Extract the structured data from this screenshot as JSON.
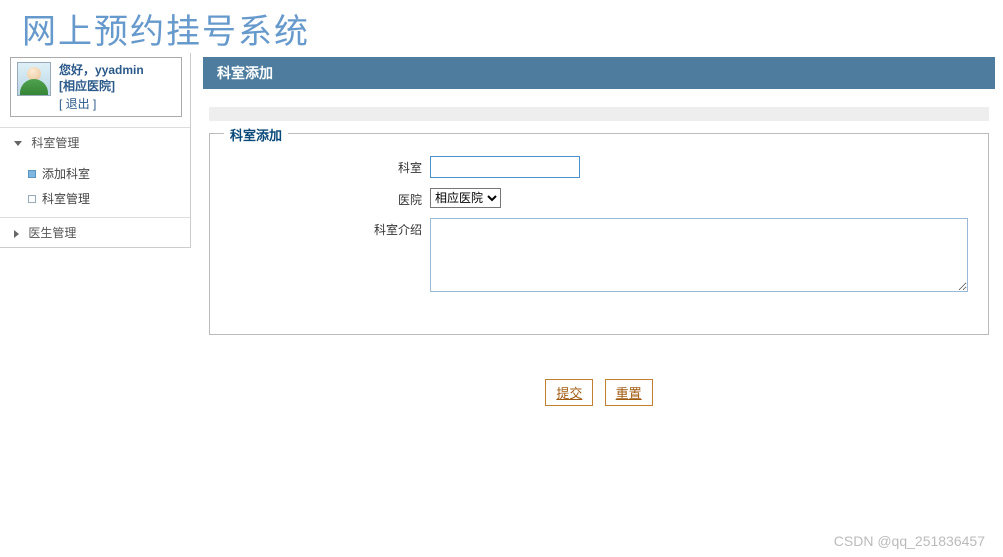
{
  "app": {
    "title": "网上预约挂号系统"
  },
  "user": {
    "greeting": "您好，",
    "name": "yyadmin",
    "hospital": "[相应医院]",
    "logout_label": "[ 退出 ]"
  },
  "sidebar": {
    "groups": [
      {
        "label": "科室管理",
        "expanded": true,
        "children": [
          {
            "label": "添加科室",
            "active": true
          },
          {
            "label": "科室管理",
            "active": false
          }
        ]
      },
      {
        "label": "医生管理",
        "expanded": false,
        "children": []
      }
    ]
  },
  "page": {
    "title": "科室添加",
    "fieldset_legend": "科室添加",
    "form": {
      "dept_label": "科室",
      "dept_value": "",
      "hospital_label": "医院",
      "hospital_selected": "相应医院",
      "intro_label": "科室介绍",
      "intro_value": ""
    },
    "buttons": {
      "submit": "提交",
      "reset": "重置"
    }
  },
  "watermark": "CSDN @qq_251836457"
}
